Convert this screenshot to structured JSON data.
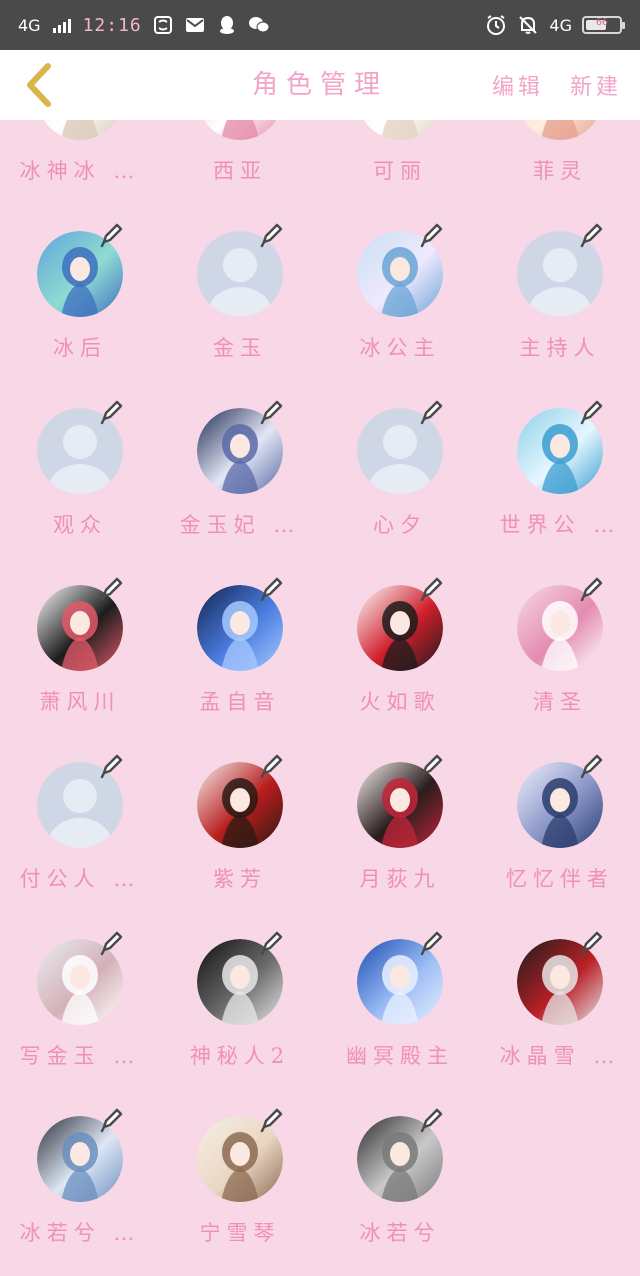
{
  "status_bar": {
    "network_label": "4G",
    "time": "12:16",
    "network_right": "4G",
    "battery_text": "66",
    "battery_level": 0.66
  },
  "header": {
    "back_icon": "chevron-left-icon",
    "title": "角色管理",
    "edit_label": "编辑",
    "new_label": "新建"
  },
  "colors": {
    "page_bg": "#f8d7e6",
    "accent_text": "#ef90b8",
    "header_text": "#f3a4c7",
    "back_chevron": "#d8b64a",
    "placeholder_avatar": "#cfd7e6",
    "edit_icon": "#4a4a4a"
  },
  "characters": [
    {
      "name": "冰神冰 …",
      "avatar": "photo",
      "palette": [
        "#e8e0d6",
        "#ffffff",
        "#d9c9b6"
      ]
    },
    {
      "name": "西亚",
      "avatar": "photo",
      "palette": [
        "#f3b3c6",
        "#ffffff",
        "#e58aa8"
      ]
    },
    {
      "name": "可丽",
      "avatar": "photo",
      "palette": [
        "#f4ece4",
        "#ffffff",
        "#e3d2c0"
      ]
    },
    {
      "name": "菲灵",
      "avatar": "photo",
      "palette": [
        "#f7c8c0",
        "#ffeede",
        "#e59f8e"
      ]
    },
    {
      "name": "冰后",
      "avatar": "photo",
      "palette": [
        "#5ea3d9",
        "#8fdcd2",
        "#3e6fbf"
      ]
    },
    {
      "name": "金玉",
      "avatar": "default",
      "palette": []
    },
    {
      "name": "冰公主",
      "avatar": "photo",
      "palette": [
        "#c8dff1",
        "#f0e9ff",
        "#6aa4d6"
      ]
    },
    {
      "name": "主持人",
      "avatar": "default",
      "palette": []
    },
    {
      "name": "观众",
      "avatar": "default",
      "palette": []
    },
    {
      "name": "金玉妃 …",
      "avatar": "photo",
      "palette": [
        "#1e2a55",
        "#e3e6f4",
        "#5a6aa8"
      ]
    },
    {
      "name": "心夕",
      "avatar": "default",
      "palette": []
    },
    {
      "name": "世界公 …",
      "avatar": "photo",
      "palette": [
        "#8fd0ea",
        "#e5f6ff",
        "#3b9ed0"
      ]
    },
    {
      "name": "萧风川",
      "avatar": "photo",
      "palette": [
        "#ffffff",
        "#1c1c1c",
        "#e35b6a"
      ]
    },
    {
      "name": "孟自音",
      "avatar": "photo",
      "palette": [
        "#11234d",
        "#4b7de0",
        "#a7c8ff"
      ]
    },
    {
      "name": "火如歌",
      "avatar": "photo",
      "palette": [
        "#ffffff",
        "#cf1f2b",
        "#1c1c1c"
      ]
    },
    {
      "name": "清圣",
      "avatar": "photo",
      "palette": [
        "#f7d9e3",
        "#e48bb0",
        "#ffffff"
      ]
    },
    {
      "name": "付公人 …",
      "avatar": "default",
      "palette": []
    },
    {
      "name": "紫芳",
      "avatar": "photo",
      "palette": [
        "#f4f1ee",
        "#b81d1d",
        "#2a1a14"
      ]
    },
    {
      "name": "月荻九",
      "avatar": "photo",
      "palette": [
        "#f6f2f0",
        "#2a1d1d",
        "#c2253a"
      ]
    },
    {
      "name": "忆忆伴者",
      "avatar": "photo",
      "palette": [
        "#eef0fb",
        "#8a95c8",
        "#2b3d6e"
      ]
    },
    {
      "name": "写金玉 …",
      "avatar": "photo",
      "palette": [
        "#e8eef0",
        "#d4b0b8",
        "#ffffff"
      ]
    },
    {
      "name": "神秘人2",
      "avatar": "photo",
      "palette": [
        "#0f0f0f",
        "#6b6b6b",
        "#e8e8e8"
      ]
    },
    {
      "name": "幽冥殿主",
      "avatar": "photo",
      "palette": [
        "#1b4fb5",
        "#9bbcf4",
        "#e9f0ff"
      ]
    },
    {
      "name": "冰晶雪 …",
      "avatar": "photo",
      "palette": [
        "#1c1c1c",
        "#b82026",
        "#e6e6e6"
      ]
    },
    {
      "name": "冰若兮 …",
      "avatar": "photo",
      "palette": [
        "#2a2f3a",
        "#dfe7f4",
        "#6b8fbf"
      ]
    },
    {
      "name": "宁雪琴",
      "avatar": "photo",
      "palette": [
        "#f7efe6",
        "#e9d6c3",
        "#8c6a52"
      ]
    },
    {
      "name": "冰若兮",
      "avatar": "photo",
      "palette": [
        "#2b2b2b",
        "#c9c9c9",
        "#7a7a7a"
      ]
    }
  ]
}
